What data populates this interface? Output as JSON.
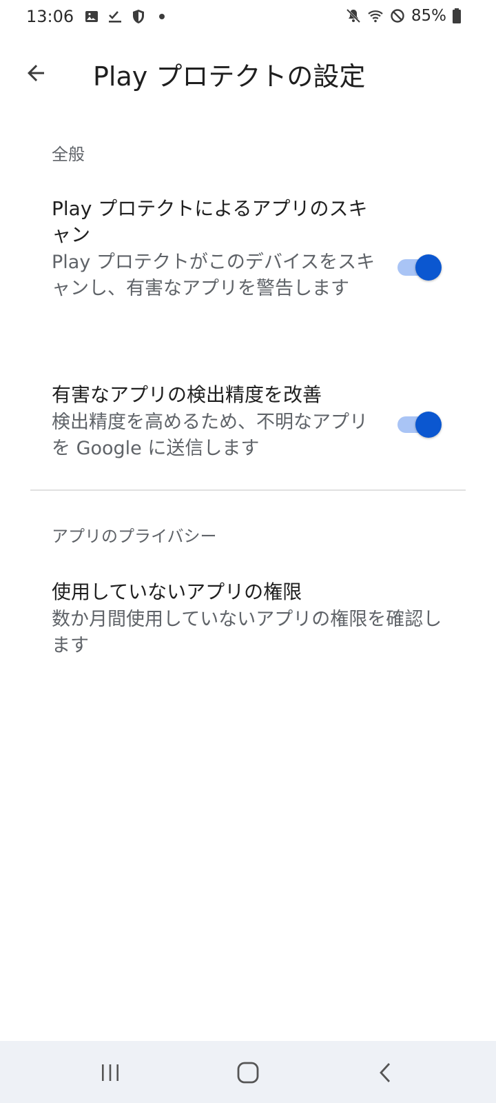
{
  "status_bar": {
    "time": "13:06",
    "battery_percent": "85%",
    "left_icons": [
      "image-icon",
      "checklist-icon",
      "shield-icon",
      "dot-icon"
    ],
    "right_icons": [
      "mute-icon",
      "wifi-icon",
      "blocked-icon",
      "battery-icon"
    ]
  },
  "app_bar": {
    "title": "Play プロテクトの設定",
    "back_icon": "arrow-back-icon"
  },
  "sections": [
    {
      "header": "全般",
      "items": [
        {
          "title": "Play プロテクトによるアプリのスキャン",
          "summary": "Play プロテクトがこのデバイスをスキャンし、有害なアプリを警告します",
          "switch_on": true
        },
        {
          "title": "有害なアプリの検出精度を改善",
          "summary": "検出精度を高めるため、不明なアプリを Google に送信します",
          "switch_on": true
        }
      ]
    },
    {
      "header": "アプリのプライバシー",
      "items": [
        {
          "title": "使用していないアプリの権限",
          "summary": "数か月間使用していないアプリの権限を確認します"
        }
      ]
    }
  ],
  "nav_bar": {
    "buttons": [
      "recent-apps-icon",
      "home-icon",
      "back-icon"
    ]
  },
  "colors": {
    "accent": "#0b57d0",
    "switch_track": "#a9c4f5",
    "nav_background": "#eef1f6",
    "divider": "#e0e0e0",
    "secondary_text": "#5f6368"
  }
}
